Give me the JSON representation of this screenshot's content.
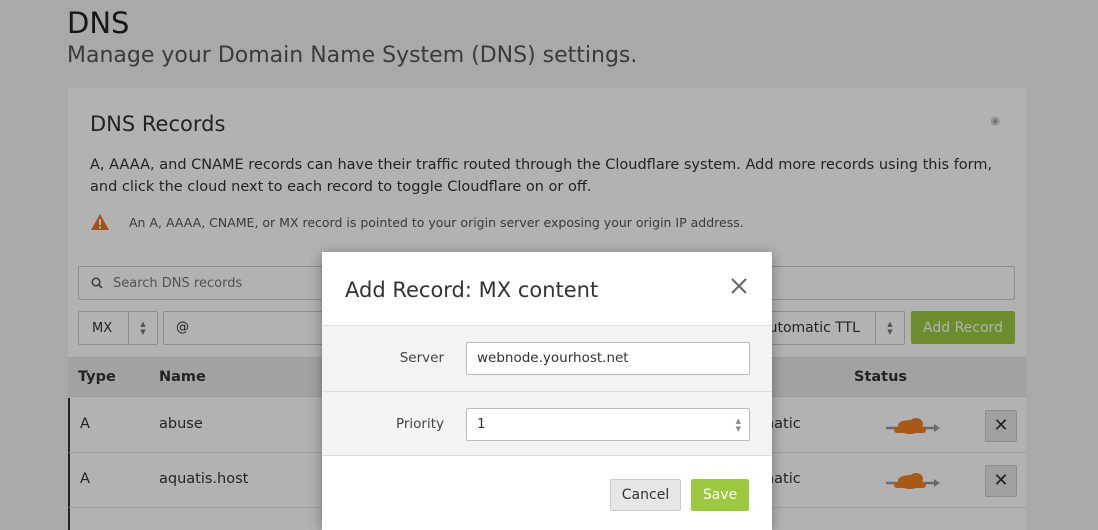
{
  "page": {
    "title": "DNS",
    "subtitle": "Manage your Domain Name System (DNS) settings."
  },
  "card": {
    "title": "DNS Records",
    "help_icon": "help-icon",
    "description": "A, AAAA, and CNAME records can have their traffic routed through the Cloudflare system. Add more records using this form, and click the cloud next to each record to toggle Cloudflare on or off.",
    "warning": "An A, AAAA, CNAME, or MX record is pointed to your origin server exposing your origin IP address."
  },
  "search": {
    "placeholder": "Search DNS records"
  },
  "add_form": {
    "type_value": "MX",
    "name_value": "@",
    "ttl_value": "Automatic TTL",
    "add_label": "Add Record"
  },
  "table": {
    "headers": {
      "type": "Type",
      "name": "Name",
      "status": "Status"
    },
    "rows": [
      {
        "type": "A",
        "name": "abuse",
        "ttl": "matic"
      },
      {
        "type": "A",
        "name": "aquatis.host",
        "ttl": "matic"
      }
    ]
  },
  "modal": {
    "title": "Add Record: MX content",
    "server_label": "Server",
    "server_value": "webnode.yourhost.net",
    "priority_label": "Priority",
    "priority_value": "1",
    "cancel_label": "Cancel",
    "save_label": "Save"
  },
  "colors": {
    "accent_green": "#9bca3e",
    "warning_orange": "#e8732d",
    "cloud_orange": "#f38020",
    "cloud_gray": "#999999"
  }
}
